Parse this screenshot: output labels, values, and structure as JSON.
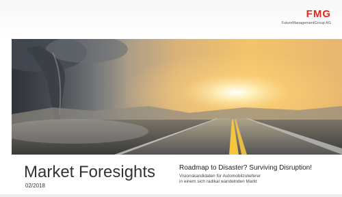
{
  "header": {
    "logo_text": "FMG",
    "logo_subtitle": "FutureManagementGroup AG",
    "brand_color": "#e2271b"
  },
  "hero": {
    "image_description_icon": "storm-road-sunset-image"
  },
  "footer": {
    "title": "Market Foresights",
    "date": "02/2018",
    "headline": "Roadmap to Disaster? Surviving Disruption!",
    "subline_1": "Visionskandidaten für Automobilzulieferer",
    "subline_2": "in einem sich radikal wandelnden Markt"
  }
}
